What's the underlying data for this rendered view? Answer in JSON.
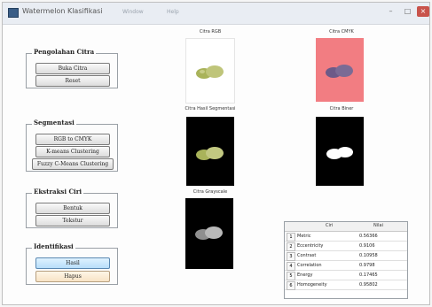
{
  "window": {
    "title": "Watermelon Klasifikasi",
    "menus": [
      "Window",
      "Help"
    ]
  },
  "panels": {
    "preprocess": {
      "title": "Pengolahan Citra",
      "buttons": [
        "Buka Citra",
        "Reset"
      ]
    },
    "segment": {
      "title": "Segmentasi",
      "buttons": [
        "RGB to CMYK",
        "K-means Clustering",
        "Fuzzy C-Means Clustering"
      ]
    },
    "extract": {
      "title": "Ekstraksi Ciri",
      "buttons": [
        "Bentuk",
        "Tekstur"
      ]
    },
    "identify": {
      "title": "Identifikasi",
      "buttons": [
        "Hasil",
        "Hapus"
      ]
    }
  },
  "images": {
    "original": {
      "label": "Citra RGB"
    },
    "cmyk": {
      "label": "Citra CMYK"
    },
    "segmented": {
      "label": "Citra Hasil Segmentasi"
    },
    "binary": {
      "label": "Citra Biner"
    },
    "gray": {
      "label": "Citra Grayscale"
    }
  },
  "features_table": {
    "headers": [
      "Ciri",
      "Nilai"
    ],
    "rows": [
      {
        "num": "1",
        "name": "Metric",
        "value": "0.56366"
      },
      {
        "num": "2",
        "name": "Eccentricity",
        "value": "0.9106"
      },
      {
        "num": "3",
        "name": "Contrast",
        "value": "0.10958"
      },
      {
        "num": "4",
        "name": "Correlation",
        "value": "0.9798"
      },
      {
        "num": "5",
        "name": "Energy",
        "value": "0.17465"
      },
      {
        "num": "6",
        "name": "Homogeneity",
        "value": "0.95802"
      }
    ]
  },
  "colors": {
    "cmyk_bg": "#f07f83",
    "dark_bg": "#000000",
    "egg": "#b9bf73"
  }
}
